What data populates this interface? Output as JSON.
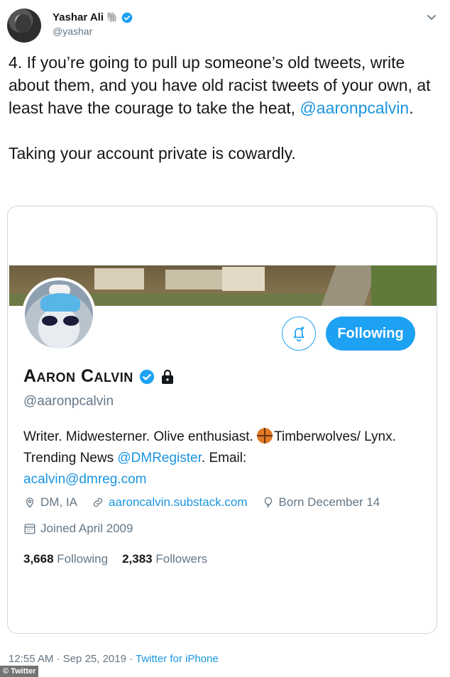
{
  "author": {
    "name": "Yashar Ali",
    "emoji": "🐘",
    "handle": "@yashar"
  },
  "tweet": {
    "text_line1": "4. If you’re going to pull up someone’s old tweets, write about them, and you have old racist tweets of your own, at least have the courage to take the heat, ",
    "mention": "@aaronpcalvin",
    "text_line1_end": ".",
    "text_line2": "Taking your account private is cowardly."
  },
  "profile": {
    "name": "Aaron Calvin",
    "handle": "@aaronpcalvin",
    "follow_button_label": "Following",
    "bio_part1": "Writer. Midwesterner. Olive enthusiast. ",
    "bio_part2": "Timberwolves/ Lynx. Trending News ",
    "bio_mention": "@DMRegister",
    "bio_part3": ". Email: ",
    "bio_email": "acalvin@dmreg.com",
    "location": "DM, IA",
    "website": "aaroncalvin.substack.com",
    "birthday": "Born December 14",
    "joined": "Joined April 2009",
    "following_count": "3,668",
    "following_label": "Following",
    "followers_count": "2,383",
    "followers_label": "Followers"
  },
  "footer": {
    "timestamp": "12:55 AM · Sep 25, 2019 · ",
    "source": "Twitter for iPhone"
  },
  "watermark": {
    "label": "© Twitter"
  },
  "colors": {
    "accent": "#1da1f2",
    "link": "#1b95e0",
    "muted": "#657786"
  }
}
